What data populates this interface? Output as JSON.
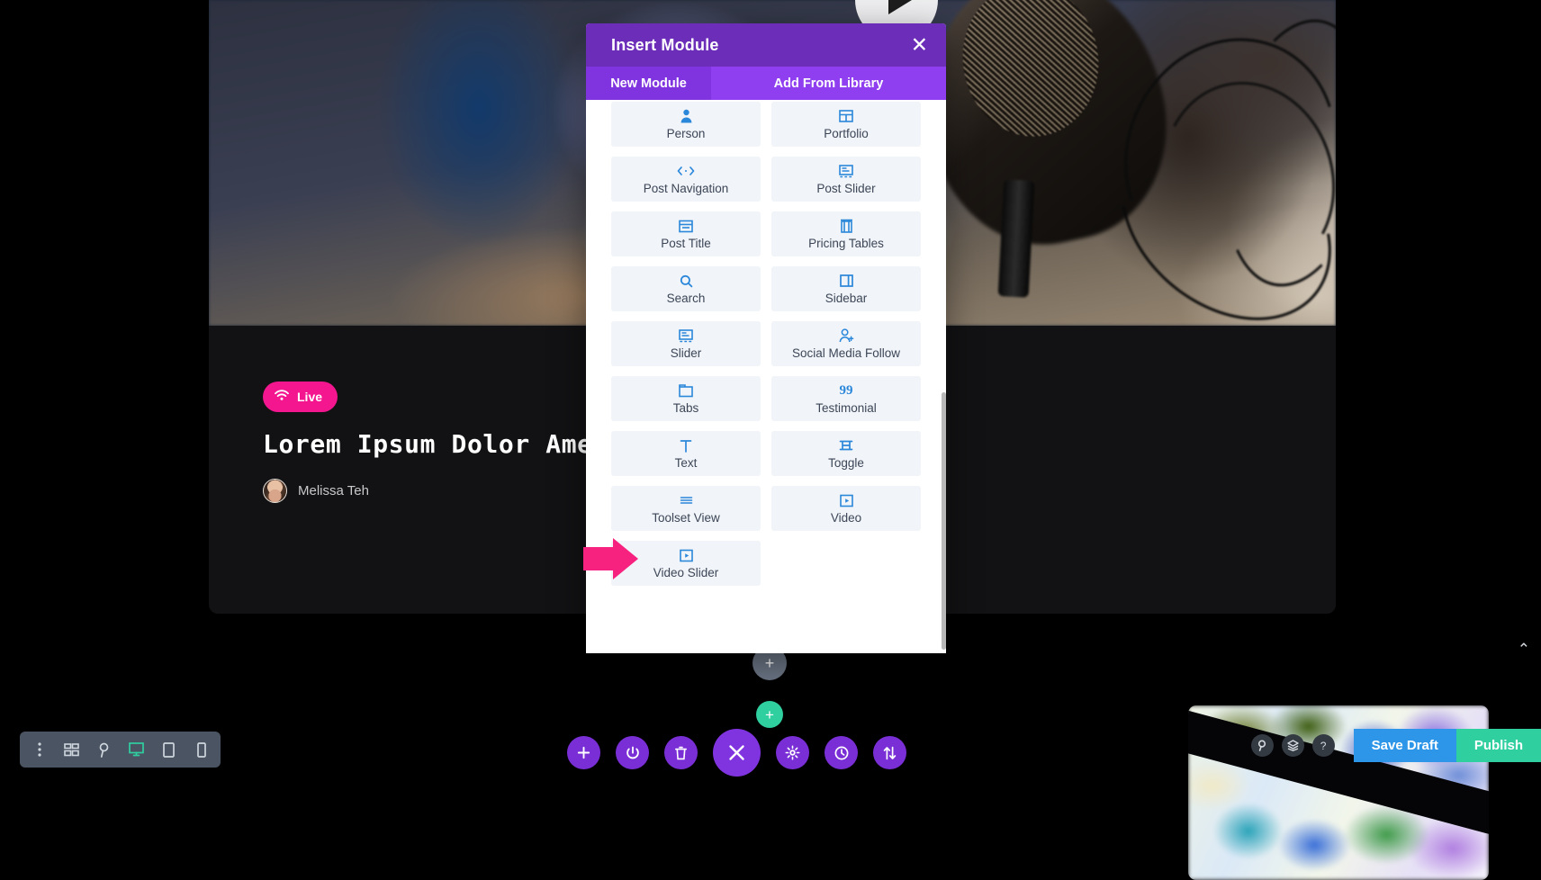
{
  "modal": {
    "title": "Insert Module",
    "close_icon": "close-icon",
    "tabs": [
      {
        "label": "New Module",
        "active": true
      },
      {
        "label": "Add From Library",
        "active": false
      }
    ],
    "modules": [
      {
        "label": "Person",
        "icon": "person-icon"
      },
      {
        "label": "Portfolio",
        "icon": "grid-icon"
      },
      {
        "label": "Post Navigation",
        "icon": "code-arrows-icon"
      },
      {
        "label": "Post Slider",
        "icon": "post-slider-icon"
      },
      {
        "label": "Post Title",
        "icon": "post-title-icon"
      },
      {
        "label": "Pricing Tables",
        "icon": "pricing-box-icon"
      },
      {
        "label": "Search",
        "icon": "search-icon"
      },
      {
        "label": "Sidebar",
        "icon": "sidebar-icon"
      },
      {
        "label": "Slider",
        "icon": "slider-icon"
      },
      {
        "label": "Social Media Follow",
        "icon": "person-add-icon"
      },
      {
        "label": "Tabs",
        "icon": "tabs-icon"
      },
      {
        "label": "Testimonial",
        "icon": "quote-icon"
      },
      {
        "label": "Text",
        "icon": "text-t-icon"
      },
      {
        "label": "Toggle",
        "icon": "toggle-icon"
      },
      {
        "label": "Toolset View",
        "icon": "list-lines-icon"
      },
      {
        "label": "Video",
        "icon": "video-icon"
      },
      {
        "label": "Video Slider",
        "icon": "video-slider-icon"
      }
    ]
  },
  "page": {
    "live_badge": {
      "label": "Live",
      "icon": "wifi-icon",
      "color": "#f4168f"
    },
    "post_title": "Lorem Ipsum Dolor Amet Sit",
    "author": "Melissa Teh",
    "play_button_icon": "play-icon"
  },
  "canvas": {
    "grey_add_label": "+",
    "teal_add_label": "+",
    "collapse_caret": "⌃"
  },
  "toolbar": {
    "left_tools": [
      {
        "name": "more-options-icon",
        "active": false
      },
      {
        "name": "wireframe-icon",
        "active": false
      },
      {
        "name": "zoom-icon",
        "active": false
      },
      {
        "name": "desktop-icon",
        "active": true
      },
      {
        "name": "tablet-icon",
        "active": false
      },
      {
        "name": "phone-icon",
        "active": false
      }
    ],
    "center_tools": [
      {
        "name": "add-section-icon"
      },
      {
        "name": "power-icon"
      },
      {
        "name": "trash-icon"
      },
      {
        "name": "close-editor-icon"
      },
      {
        "name": "settings-gear-icon"
      },
      {
        "name": "history-clock-icon"
      },
      {
        "name": "sort-updown-icon"
      }
    ],
    "right_tools": [
      {
        "name": "search-icon"
      },
      {
        "name": "layers-icon"
      },
      {
        "name": "help-icon"
      }
    ],
    "save_label": "Save Draft",
    "publish_label": "Publish",
    "save_color": "#2d96e8",
    "publish_color": "#2fcfa0"
  }
}
